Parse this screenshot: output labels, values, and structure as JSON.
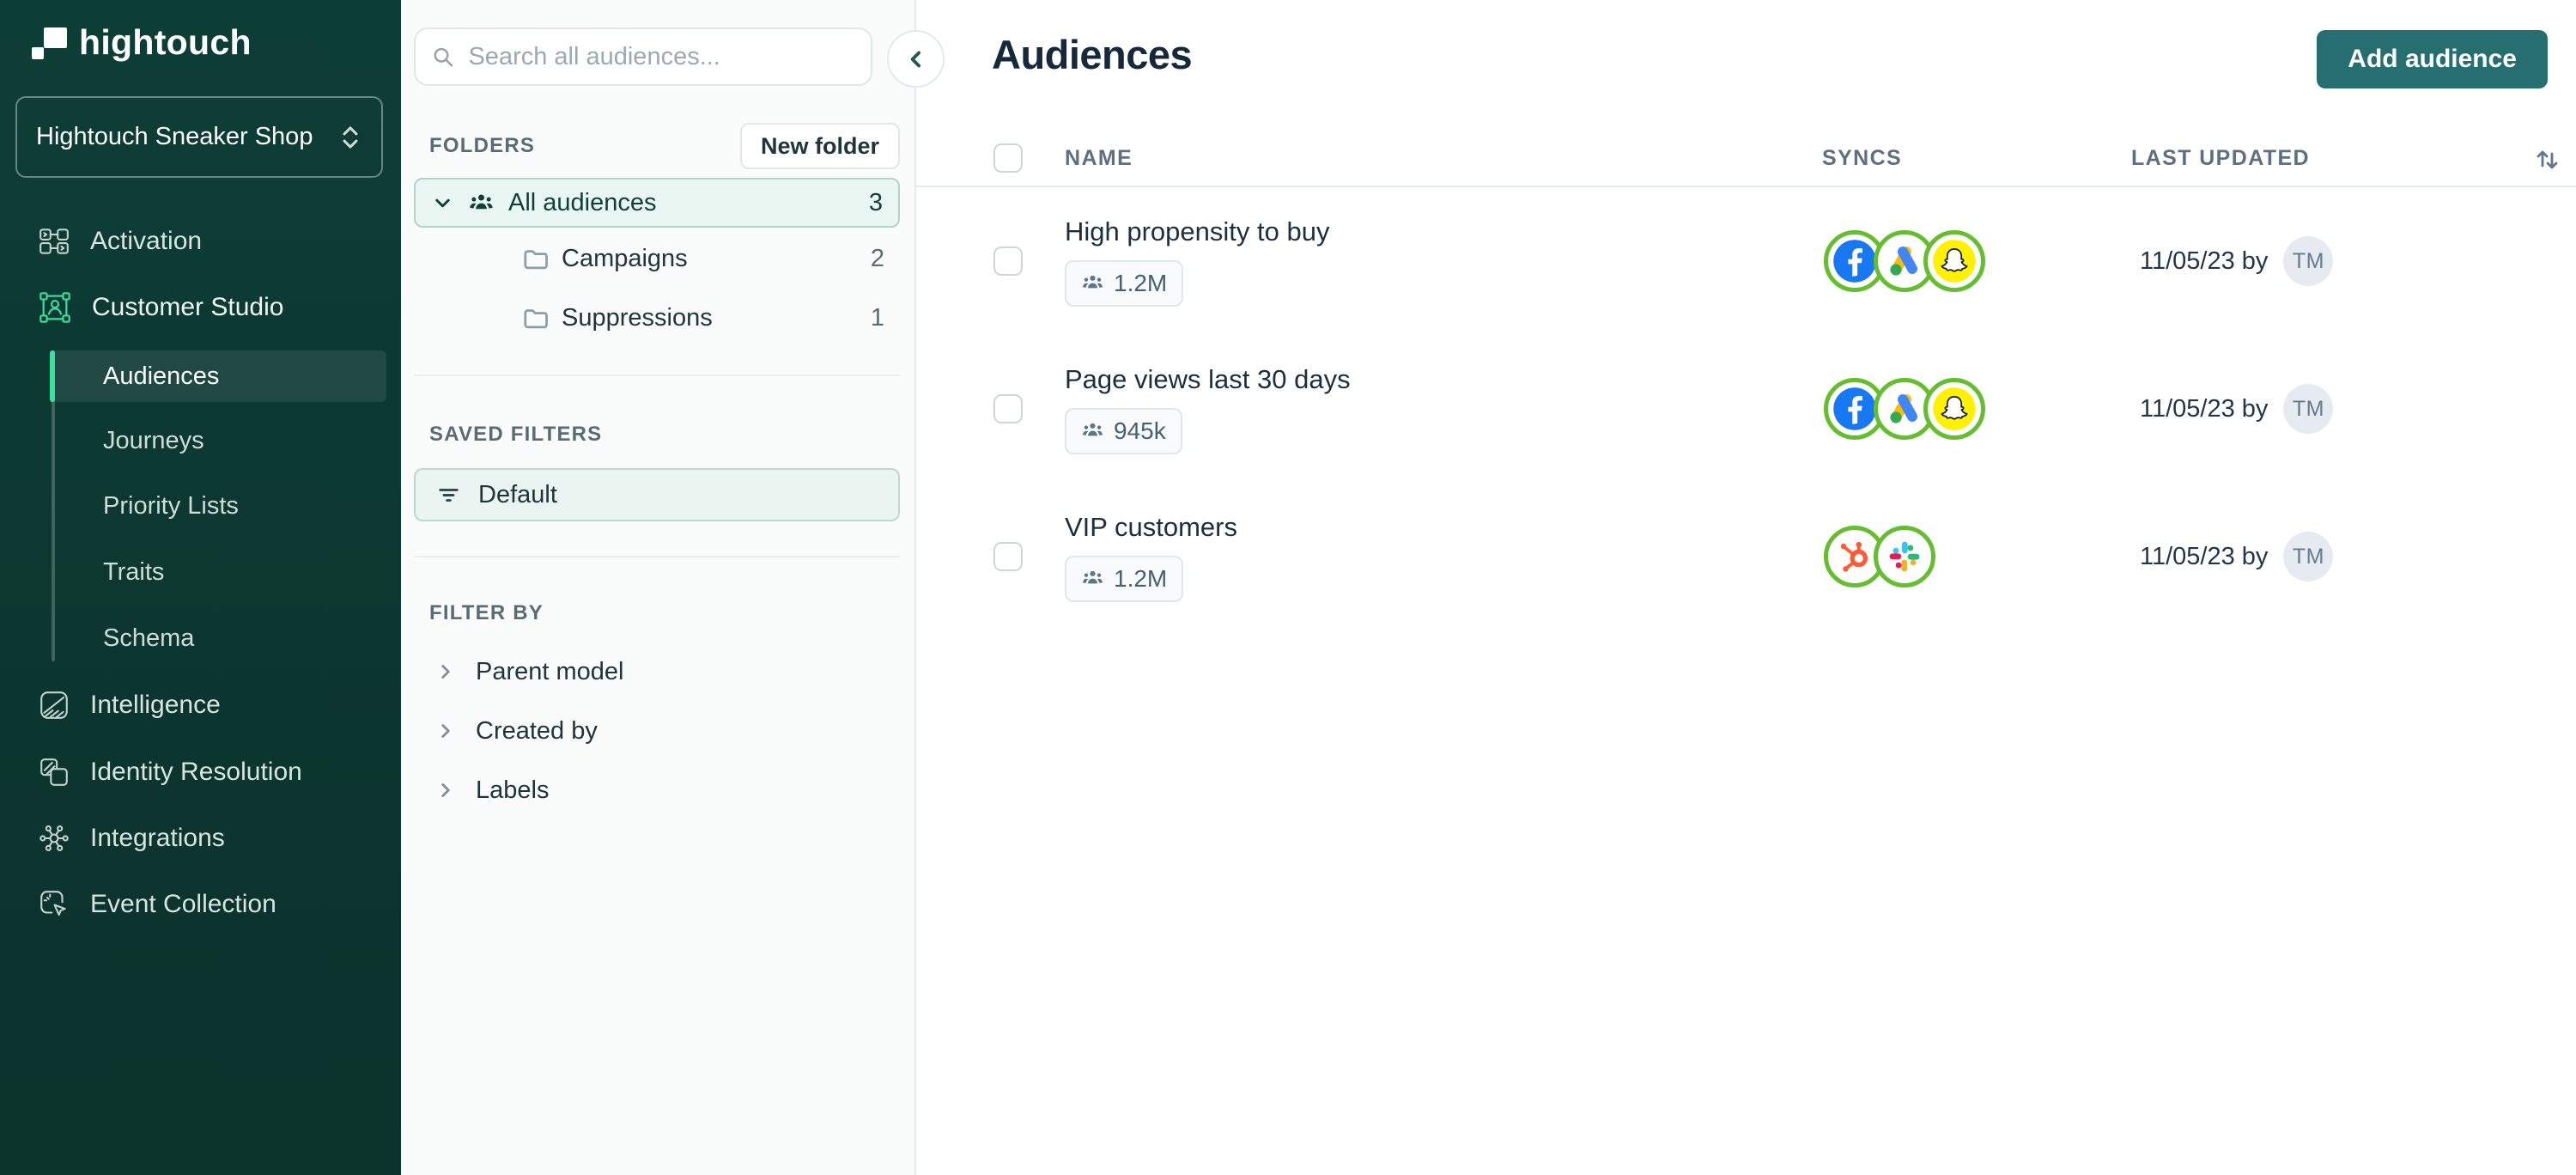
{
  "brand": {
    "logo_text": "hightouch",
    "workspace_name": "Hightouch Sneaker Shop"
  },
  "sidebar": {
    "items": [
      {
        "label": "Activation",
        "icon": "workflow-icon"
      },
      {
        "label": "Customer Studio",
        "icon": "customer-studio-icon",
        "children": [
          {
            "label": "Audiences",
            "active": true
          },
          {
            "label": "Journeys"
          },
          {
            "label": "Priority Lists"
          },
          {
            "label": "Traits"
          },
          {
            "label": "Schema"
          }
        ]
      },
      {
        "label": "Intelligence",
        "icon": "intelligence-icon"
      },
      {
        "label": "Identity Resolution",
        "icon": "identity-resolution-icon"
      },
      {
        "label": "Integrations",
        "icon": "integrations-icon"
      },
      {
        "label": "Event Collection",
        "icon": "event-collection-icon"
      }
    ]
  },
  "panel": {
    "search_placeholder": "Search all audiences...",
    "folders_label": "FOLDERS",
    "new_folder_button": "New folder",
    "all_audiences": {
      "label": "All audiences",
      "count": "3"
    },
    "folders": [
      {
        "name": "Campaigns",
        "count": "2"
      },
      {
        "name": "Suppressions",
        "count": "1"
      }
    ],
    "saved_filters_label": "SAVED FILTERS",
    "saved_filter_name": "Default",
    "filter_by_label": "FILTER BY",
    "filters": [
      {
        "label": "Parent model"
      },
      {
        "label": "Created by"
      },
      {
        "label": "Labels"
      }
    ]
  },
  "main": {
    "title": "Audiences",
    "add_button": "Add audience",
    "table": {
      "columns": [
        "NAME",
        "SYNCS",
        "LAST UPDATED"
      ],
      "rows": [
        {
          "name": "High propensity to buy",
          "size": "1.2M",
          "syncs": [
            "facebook",
            "google-ads",
            "snapchat"
          ],
          "updated": "11/05/23 by",
          "avatar": "TM"
        },
        {
          "name": "Page views last 30 days",
          "size": "945k",
          "syncs": [
            "facebook",
            "google-ads",
            "snapchat"
          ],
          "updated": "11/05/23 by",
          "avatar": "TM"
        },
        {
          "name": "VIP customers",
          "size": "1.2M",
          "syncs": [
            "hubspot",
            "slack"
          ],
          "updated": "11/05/23 by",
          "avatar": "TM"
        }
      ]
    }
  },
  "colors": {
    "sidebar_bg": "#0c3a32",
    "accent_green": "#3fe09c",
    "sync_ring_green": "#65bd2f",
    "primary_button_teal": "#266e70",
    "selected_item_bg": "#e9f6f1"
  }
}
